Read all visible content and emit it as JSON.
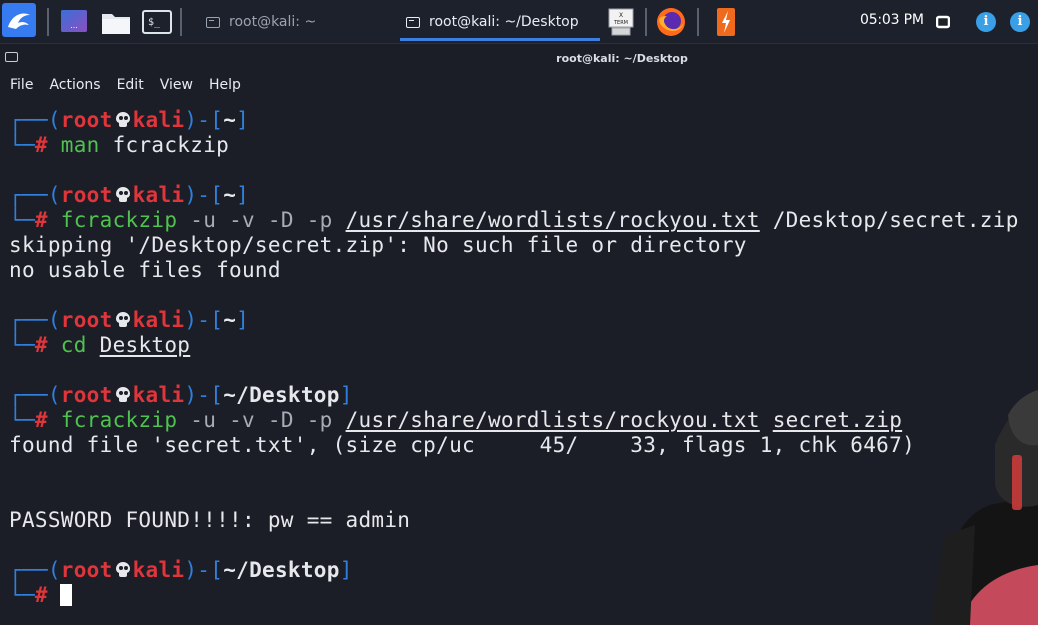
{
  "panel": {
    "tasks": [
      {
        "label": "root@kali: ~",
        "active": false
      },
      {
        "label": "root@kali: ~/Desktop",
        "active": true
      }
    ],
    "clock": "05:03 PM",
    "xterm_label": "TERM",
    "tray_info_1": "i",
    "tray_info_2": "i"
  },
  "window": {
    "title": "root@kali: ~/Desktop",
    "menu": [
      "File",
      "Actions",
      "Edit",
      "View",
      "Help"
    ]
  },
  "terminal": {
    "prompt_user": "root",
    "prompt_host": "kali",
    "blocks": [
      {
        "cwd": "~",
        "command": "man",
        "args": "fcrackzip",
        "output": []
      },
      {
        "cwd": "~",
        "command": "fcrackzip",
        "flags": "-u -v -D -p",
        "wordlist": "/usr/share/wordlists/rockyou.txt",
        "target": "/Desktop/secret.zip",
        "output": [
          "skipping '/Desktop/secret.zip': No such file or directory",
          "no usable files found"
        ]
      },
      {
        "cwd": "~",
        "command": "cd",
        "args": "Desktop",
        "output": []
      },
      {
        "cwd": "~/Desktop",
        "command": "fcrackzip",
        "flags": "-u -v -D -p",
        "wordlist": "/usr/share/wordlists/rockyou.txt",
        "target": "secret.zip",
        "output": [
          "found file 'secret.txt', (size cp/uc     45/    33, flags 1, chk 6467)",
          "",
          "",
          "PASSWORD FOUND!!!!: pw == admin"
        ]
      },
      {
        "cwd": "~/Desktop",
        "command": "",
        "output": []
      }
    ]
  },
  "colors": {
    "prompt_frame": "#2f7fdc",
    "prompt_user": "#e0353b",
    "command": "#4fc24f",
    "flags": "#a7abb5",
    "background": "#1b1e26"
  }
}
